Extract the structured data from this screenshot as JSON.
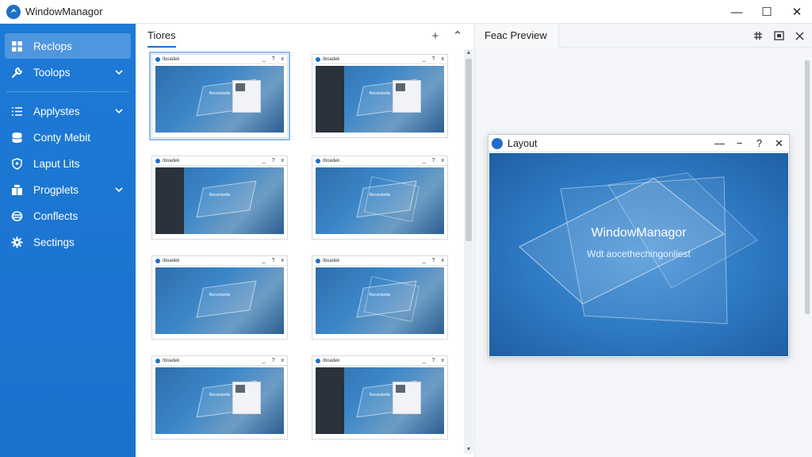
{
  "app": {
    "title": "WindowManagor"
  },
  "window_controls": {
    "minimize": "—",
    "maximize": "☐",
    "close": "✕"
  },
  "sidebar": {
    "items": [
      {
        "label": "Reclops",
        "icon": "grid-icon",
        "active": true,
        "expandable": false
      },
      {
        "label": "Toolops",
        "icon": "wrench-icon",
        "active": false,
        "expandable": true
      },
      {
        "label": "Applystes",
        "icon": "list-icon",
        "active": false,
        "expandable": true
      },
      {
        "label": "Conty Mebit",
        "icon": "database-icon",
        "active": false,
        "expandable": false
      },
      {
        "label": "Laput Lits",
        "icon": "shield-icon",
        "active": false,
        "expandable": false
      },
      {
        "label": "Progplets",
        "icon": "puzzle-icon",
        "active": false,
        "expandable": true
      },
      {
        "label": "Conflects",
        "icon": "stack-icon",
        "active": false,
        "expandable": false
      },
      {
        "label": "Sectings",
        "icon": "gear-icon",
        "active": false,
        "expandable": false
      }
    ]
  },
  "middle": {
    "tab": "Tiores",
    "add_label": "+",
    "collapse_label": "⌃",
    "thumb_caption": "Iboadek",
    "thumb_label": "Recordunlie",
    "thumb_controls": [
      "_",
      "?",
      "x"
    ]
  },
  "right": {
    "tab": "Feac Preview",
    "preview": {
      "title": "Layout",
      "controls": [
        "—",
        "−",
        "?",
        "✕"
      ],
      "heading": "WindowManagor",
      "subtext": "Wdt aocethechingonliest"
    }
  },
  "colors": {
    "accent": "#1e6fc9",
    "sidebar": "#1d7ad6"
  }
}
